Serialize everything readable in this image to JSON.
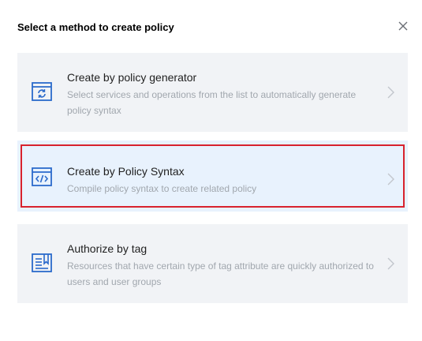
{
  "dialog": {
    "title": "Select a method to create policy"
  },
  "options": [
    {
      "title": "Create by policy generator",
      "description": "Select services and operations from the list to automatically generate policy syntax",
      "icon": "policy-generator-icon",
      "selected": false
    },
    {
      "title": "Create by Policy Syntax",
      "description": "Compile policy syntax to create related policy",
      "icon": "code-icon",
      "selected": true
    },
    {
      "title": "Authorize by tag",
      "description": "Resources that have certain type of tag attribute are quickly authorized to users and user groups",
      "icon": "tag-document-icon",
      "selected": false
    }
  ],
  "colors": {
    "accent_blue": "#2b6acb",
    "card_bg": "#f1f3f6",
    "selected_bg": "#e8f2fd",
    "highlight_red": "#d8222d",
    "desc_gray": "#a1a7ae"
  }
}
